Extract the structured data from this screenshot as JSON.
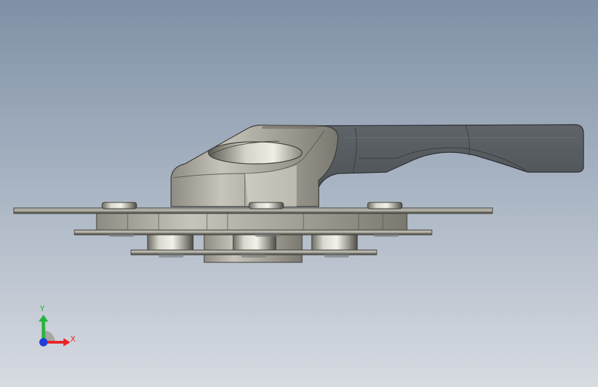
{
  "viewport": {
    "background_top": "#7f90a6",
    "background_bottom": "#d7dbe2"
  },
  "triad": {
    "x_label": "X",
    "y_label": "Y",
    "x_color": "#e8262a",
    "y_color": "#27b43c",
    "z_color": "#1f3fd8"
  }
}
